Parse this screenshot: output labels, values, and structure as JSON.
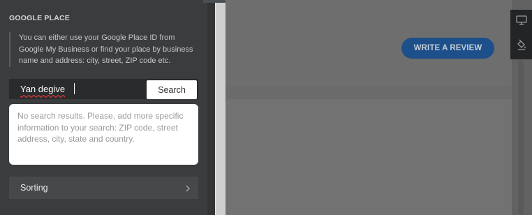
{
  "panel": {
    "section_title": "GOOGLE PLACE",
    "hint": "You can either use your Google Place ID from Google My Business or find your place by business name and address: city, street, ZIP code etc.",
    "search": {
      "value": "Yan degive",
      "button_label": "Search"
    },
    "results_message": "No search results. Please, add more specific information to your search: ZIP code, street address, city, state and country.",
    "sorting_label": "Sorting"
  },
  "preview": {
    "write_review_label": "WRITE A REVIEW"
  },
  "toolbar": {
    "icons": [
      "desktop-icon",
      "paint-bucket-icon"
    ]
  },
  "colors": {
    "panel_bg": "#3b3c3e",
    "accent_button": "#1d4f8a",
    "preview_bg": "#6b6b6b"
  }
}
